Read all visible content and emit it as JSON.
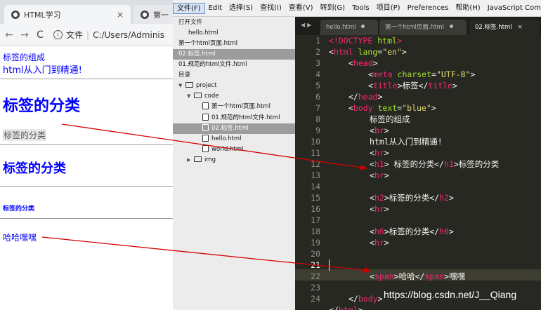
{
  "browser": {
    "tabs": [
      {
        "label": "HTML学习",
        "close": "×"
      },
      {
        "label": "第一"
      }
    ],
    "address": {
      "back": "←",
      "forward": "→",
      "reload": "C",
      "info": "i",
      "scheme": "文件",
      "path": "C:/Users/Adminis"
    },
    "page": {
      "text1": "标签的组成",
      "text2": "html从入门到精通!",
      "h1": "标签的分类",
      "h1_tail": "标签的分类",
      "h2": "标签的分类",
      "h6": "标签的分类",
      "span": "哈哈嘿嘿"
    }
  },
  "editor": {
    "menu": [
      "文件(F)",
      "Edit",
      "选择(S)",
      "查找(I)",
      "查看(V)",
      "转到(G)",
      "Tools",
      "项目(P)",
      "Preferences",
      "帮助(H)",
      "JavaScript Complet"
    ],
    "sidebar": {
      "open_files_heading": "打开文件",
      "open_files": [
        "hello.html",
        "第一个html页面.html",
        "02.标签.html",
        "01.规范的html文件.html"
      ],
      "folders_heading": "目录",
      "project": "project",
      "code_folder": "code",
      "code_files": [
        "第一个html页面.html",
        "01.规范的html文件.html",
        "02.标签.html",
        "hello.html",
        "world.html"
      ],
      "img_folder": "img"
    },
    "tabs": [
      {
        "label": "hello.html"
      },
      {
        "label": "第一个html页面.html"
      },
      {
        "label": "02.标签.html",
        "close": "×"
      }
    ],
    "line_numbers": [
      "1",
      "2",
      "3",
      "4",
      "5",
      "6",
      "7",
      "8",
      "9",
      "10",
      "11",
      "12",
      "13",
      "14",
      "15",
      "16",
      "17",
      "18",
      "19",
      "20",
      "21",
      "22",
      "23",
      "24"
    ],
    "code": {
      "l1a": "<!DOCTYPE ",
      "l1b": "html",
      "l1c": ">",
      "l2a": "<",
      "l2b": "html",
      "l2c": " lang",
      "l2d": "=",
      "l2e": "\"en\"",
      "l2f": ">",
      "l3a": "<",
      "l3b": "head",
      "l3c": ">",
      "l4a": "<",
      "l4b": "meta",
      "l4c": " charset",
      "l4d": "=",
      "l4e": "\"UTF-8\"",
      "l4f": ">",
      "l5a": "<",
      "l5b": "title",
      "l5c": ">",
      "l5d": "标签",
      "l5e": "</",
      "l5f": "title",
      "l5g": ">",
      "l6a": "</",
      "l6b": "head",
      "l6c": ">",
      "l7a": "<",
      "l7b": "body",
      "l7c": " text",
      "l7d": "=",
      "l7e": "\"blue\"",
      "l7f": ">",
      "l8": "标签的组成",
      "l9a": "<",
      "l9b": "br",
      "l9c": ">",
      "l10": "html从入门到精通!",
      "l11a": "<",
      "l11b": "hr",
      "l11c": ">",
      "l12a": "<",
      "l12b": "h1",
      "l12c": "> 标签的分类",
      "l12d": "</",
      "l12e": "h1",
      "l12f": ">",
      "l12g": "标签的分类",
      "l13a": "<",
      "l13b": "hr",
      "l13c": ">",
      "l15a": "<",
      "l15b": "h2",
      "l15c": ">标签的分类",
      "l15d": "</",
      "l15e": "h2",
      "l15f": ">",
      "l16a": "<",
      "l16b": "hr",
      "l16c": ">",
      "l18a": "<",
      "l18b": "h6",
      "l18c": ">标签的分类",
      "l18d": "</",
      "l18e": "h6",
      "l18f": ">",
      "l19a": "<",
      "l19b": "hr",
      "l19c": ">",
      "l21a": "<",
      "l21b": "span",
      "l21c": ">哈哈",
      "l21d": "</",
      "l21e": "span",
      "l21f": ">",
      "l21g": "嘿嘿",
      "l23a": "</",
      "l23b": "body",
      "l23c": ">",
      "l24a": "</",
      "l24b": "html",
      "l24c": ">"
    },
    "watermark": "https://blog.csdn.net/J__Qiang"
  },
  "colors": {
    "page_text": "#0000ff",
    "editor_bg": "#272822",
    "tag": "#f92672",
    "attr": "#a6e22e",
    "string": "#e6db74",
    "arrow": "#d40000"
  }
}
